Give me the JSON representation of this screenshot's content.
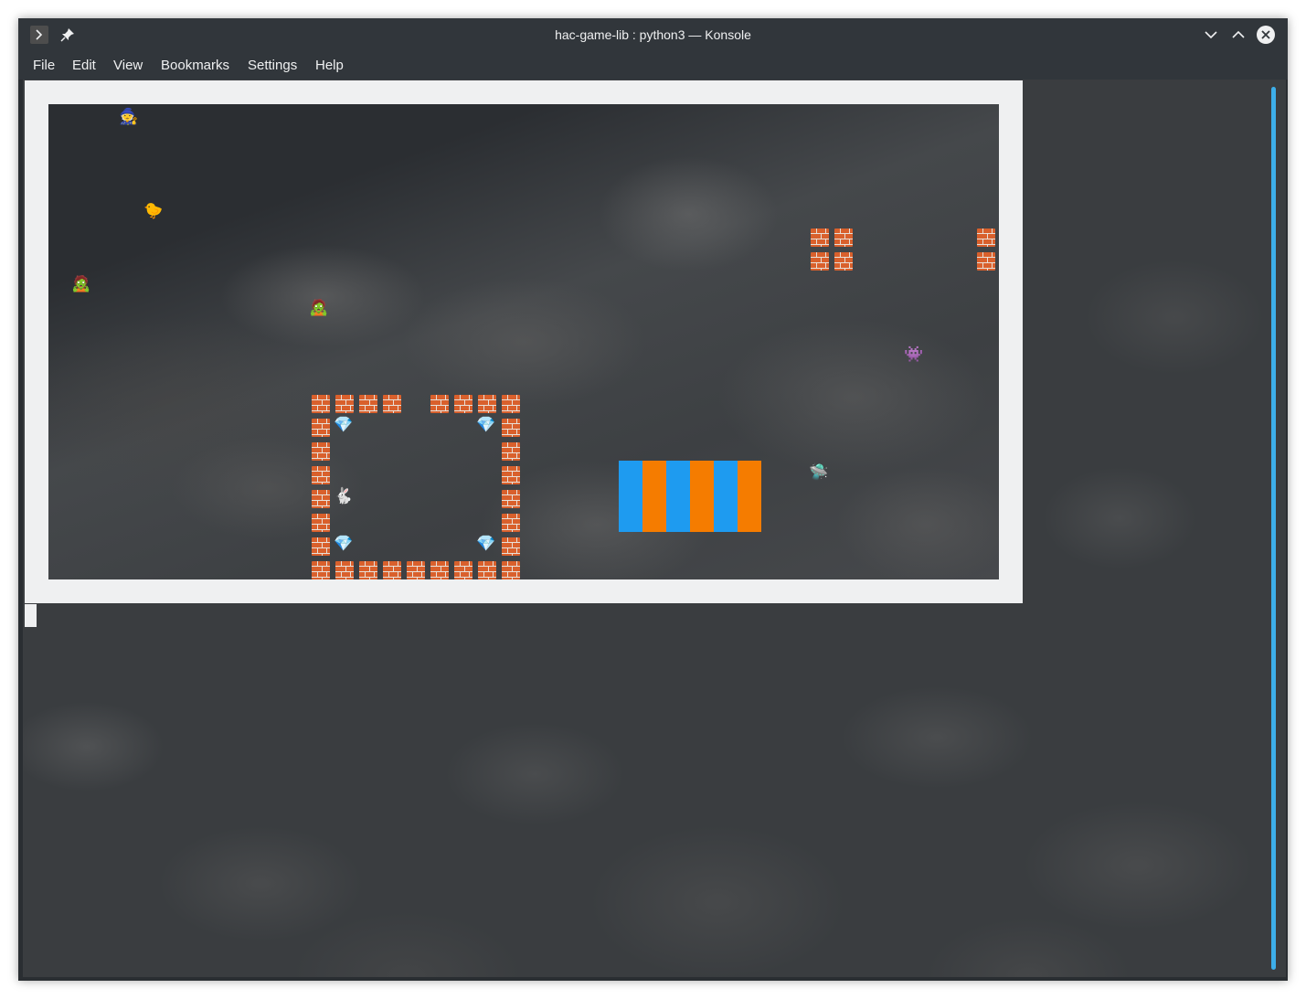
{
  "window": {
    "title": "hac-game-lib : python3 — Konsole",
    "menu": [
      "File",
      "Edit",
      "View",
      "Bookmarks",
      "Settings",
      "Help"
    ],
    "icons": {
      "app": "terminal-prompt-icon",
      "pin": "pin-icon",
      "minimize": "chevron-down-icon",
      "maximize": "chevron-up-icon",
      "close": "close-circle-icon"
    }
  },
  "colors": {
    "accent": "#3daee9",
    "titlebar": "#31363b",
    "text": "#eff0f1",
    "stripe_blue": "#1e9bf0",
    "stripe_orange": "#f57c00"
  },
  "game": {
    "sprites": {
      "witch": "🧙",
      "chick": "🐤",
      "zombie": "🧟",
      "alien": "👾",
      "ufo": "🛸",
      "gem": "💎",
      "rabbit": "🐇"
    }
  }
}
